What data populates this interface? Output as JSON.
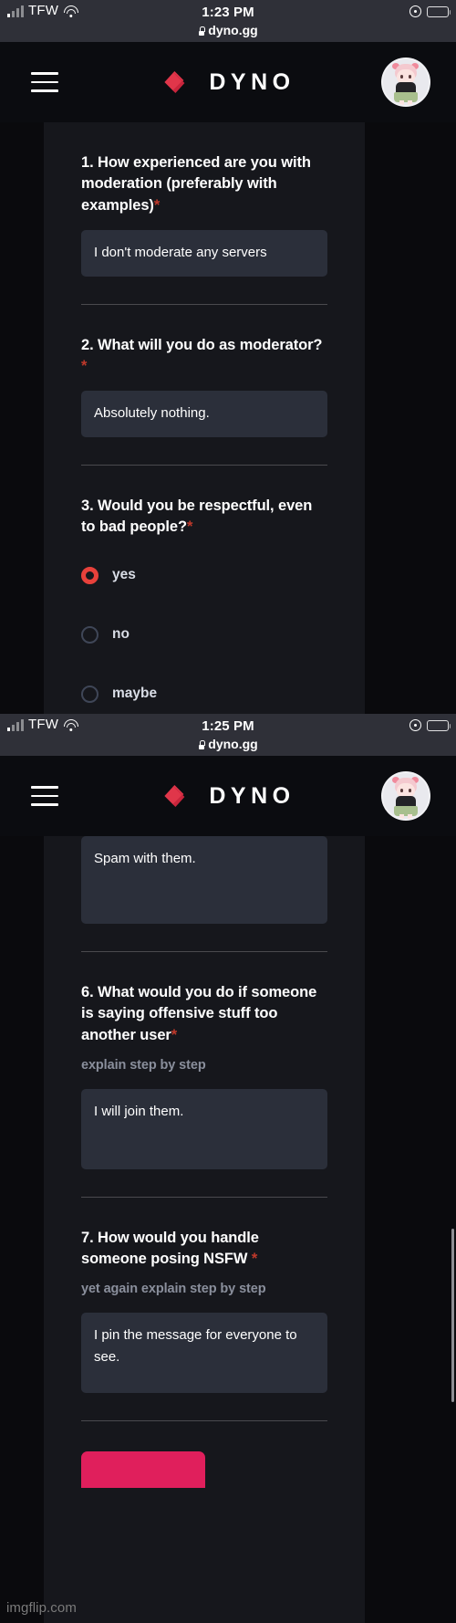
{
  "screenshots": [
    {
      "status_bar": {
        "carrier": "TFW",
        "time": "1:23 PM",
        "url": "dyno.gg",
        "signal_icon": "cellular-bars-icon",
        "wifi_icon": "wifi-icon",
        "location_icon": "location-services-icon",
        "battery_icon": "battery-icon",
        "lock_icon": "lock-icon"
      },
      "navbar": {
        "menu_icon": "hamburger-menu-icon",
        "logo_icon": "dyno-logo-icon",
        "brand": "DYNO",
        "avatar_icon": "user-avatar-icon"
      },
      "questions": [
        {
          "title": "1. How experienced are you with moderation (preferably with examples)",
          "required": "*",
          "hint": "",
          "answer": "I don't moderate any servers",
          "type": "textarea"
        },
        {
          "title": "2. What will you do as moderator?",
          "required": "*",
          "hint": "",
          "answer": "Absolutely nothing.",
          "type": "textarea"
        },
        {
          "title": "3. Would you be respectful, even to bad people?",
          "required": "*",
          "hint": "",
          "type": "radio",
          "options": [
            {
              "label": "yes",
              "selected": true
            },
            {
              "label": "no",
              "selected": false
            },
            {
              "label": "maybe",
              "selected": false
            }
          ]
        }
      ]
    },
    {
      "status_bar": {
        "carrier": "TFW",
        "time": "1:25 PM",
        "url": "dyno.gg",
        "signal_icon": "cellular-bars-icon",
        "wifi_icon": "wifi-icon",
        "location_icon": "location-services-icon",
        "battery_icon": "battery-icon",
        "lock_icon": "lock-icon"
      },
      "navbar": {
        "menu_icon": "hamburger-menu-icon",
        "logo_icon": "dyno-logo-icon",
        "brand": "DYNO",
        "avatar_icon": "user-avatar-icon"
      },
      "partial_answer_top": "Spam with them.",
      "questions": [
        {
          "title": "6. What would you do if someone is saying offensive stuff too another user",
          "required": "*",
          "hint": "explain step by step",
          "answer": "I will join them.",
          "type": "textarea"
        },
        {
          "title": "7. How would you handle someone posing NSFW ",
          "required": "*",
          "hint": "yet again explain step by step",
          "answer": "I pin the message for everyone to see.",
          "type": "textarea"
        }
      ],
      "submit_button_label": ""
    }
  ],
  "watermark": "imgflip.com",
  "colors": {
    "accent_red": "#e8413b",
    "brand_red": "#e0364a",
    "submit_pink": "#e01f5c",
    "required_asterisk": "#c0392b",
    "page_bg": "#16171c",
    "letterbox_bg": "#0a0a0d",
    "input_bg": "#2b2f3a",
    "status_bar_bg": "#2f3038",
    "navbar_bg": "#0b0c10",
    "hint_text": "#8a8f9c"
  }
}
